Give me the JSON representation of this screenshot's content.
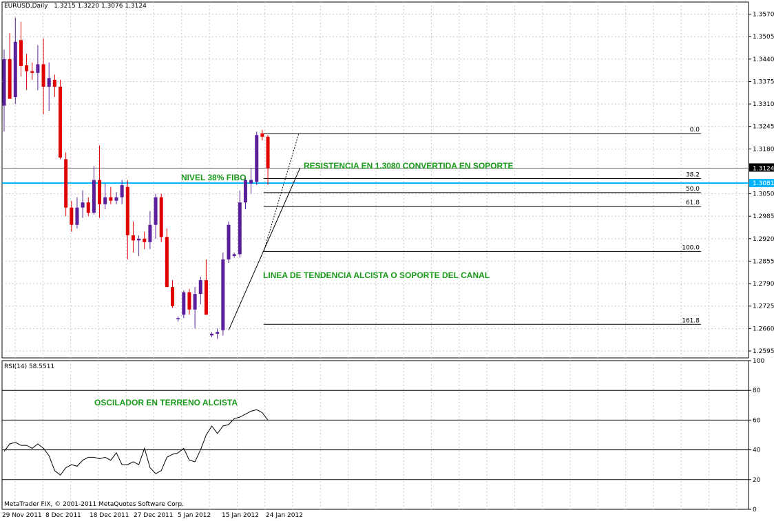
{
  "header": {
    "symbol": "EURUSD,Daily",
    "ohlc": "1.3215 1.3220 1.3076 1.3124"
  },
  "rsi_header": "RSI(14) 58.5511",
  "copyright": "MetaTrader FIX, © 2001-2011 MetaQuotes Software Corp.",
  "colors": {
    "bull": "#5b1f9c",
    "bear": "#e00000",
    "annotation": "#1a9a1a",
    "support_line": "#00b4ff",
    "grid": "#c8c8c8"
  },
  "chart_data": [
    {
      "type": "candlestick",
      "price_axis": {
        "ylim": [
          1.2575,
          1.3605
        ],
        "ticks": [
          "1.3570",
          "1.3505",
          "1.3440",
          "1.3375",
          "1.3310",
          "1.3245",
          "1.3180",
          "1.3050",
          "1.2985",
          "1.2920",
          "1.2855",
          "1.2790",
          "1.2725",
          "1.2660",
          "1.2595"
        ],
        "current_price_label": "1.3124",
        "support_label": "1.3081"
      },
      "time_axis": [
        "29 Nov 2011",
        "8 Dec 2011",
        "18 Dec 2011",
        "27 Dec 2011",
        "5 Jan 2012",
        "15 Jan 2012",
        "24 Jan 2012"
      ],
      "candles": [
        [
          1.3305,
          1.3468,
          1.323,
          1.344
        ],
        [
          1.344,
          1.3515,
          1.339,
          1.3325
        ],
        [
          1.333,
          1.356,
          1.331,
          1.349
        ],
        [
          1.3495,
          1.3548,
          1.339,
          1.342
        ],
        [
          1.3422,
          1.3455,
          1.335,
          1.3405
        ],
        [
          1.3405,
          1.343,
          1.338,
          1.34
        ],
        [
          1.34,
          1.348,
          1.335,
          1.3425
        ],
        [
          1.3425,
          1.35,
          1.328,
          1.336
        ],
        [
          1.336,
          1.343,
          1.329,
          1.3385
        ],
        [
          1.338,
          1.3395,
          1.333,
          1.336
        ],
        [
          1.336,
          1.338,
          1.315,
          1.3155
        ],
        [
          1.315,
          1.317,
          1.2985,
          1.301
        ],
        [
          1.301,
          1.303,
          1.294,
          1.296
        ],
        [
          1.296,
          1.304,
          1.295,
          1.301
        ],
        [
          1.301,
          1.306,
          1.298,
          1.3025
        ],
        [
          1.3025,
          1.304,
          1.2985,
          1.2995
        ],
        [
          1.2995,
          1.313,
          1.299,
          1.309
        ],
        [
          1.309,
          1.319,
          1.298,
          1.302
        ],
        [
          1.302,
          1.308,
          1.3005,
          1.304
        ],
        [
          1.304,
          1.307,
          1.302,
          1.303
        ],
        [
          1.303,
          1.3055,
          1.302,
          1.304
        ],
        [
          1.304,
          1.309,
          1.302,
          1.3075
        ],
        [
          1.307,
          1.309,
          1.286,
          1.293
        ],
        [
          1.293,
          1.297,
          1.288,
          1.2915
        ],
        [
          1.2915,
          1.293,
          1.287,
          1.292
        ],
        [
          1.292,
          1.294,
          1.289,
          1.291
        ],
        [
          1.291,
          1.3,
          1.289,
          1.296
        ],
        [
          1.296,
          1.305,
          1.292,
          1.304
        ],
        [
          1.304,
          1.305,
          1.291,
          1.2925
        ],
        [
          1.2925,
          1.295,
          1.278,
          1.278
        ],
        [
          1.278,
          1.28,
          1.272,
          1.2725
        ],
        [
          1.269,
          1.2695,
          1.268,
          1.269
        ],
        [
          1.27,
          1.277,
          1.269,
          1.2765
        ],
        [
          1.2765,
          1.2775,
          1.27,
          1.2715
        ],
        [
          1.2715,
          1.278,
          1.266,
          1.276
        ],
        [
          1.276,
          1.281,
          1.273,
          1.28
        ],
        [
          1.28,
          1.286,
          1.27,
          1.27
        ],
        [
          1.264,
          1.265,
          1.2635,
          1.2645
        ],
        [
          1.2645,
          1.266,
          1.263,
          1.265
        ],
        [
          1.2655,
          1.288,
          1.264,
          1.286
        ],
        [
          1.286,
          1.297,
          1.285,
          1.296
        ],
        [
          1.287,
          1.288,
          1.2865,
          1.2875
        ],
        [
          1.2875,
          1.306,
          1.2865,
          1.3025
        ],
        [
          1.3025,
          1.31,
          1.3005,
          1.309
        ],
        [
          1.308,
          1.3125,
          1.305,
          1.309
        ],
        [
          1.3085,
          1.323,
          1.3075,
          1.322
        ],
        [
          1.3225,
          1.3235,
          1.3205,
          1.3215
        ],
        [
          1.3215,
          1.322,
          1.3076,
          1.3124
        ]
      ],
      "fibonacci": {
        "high": 1.3224,
        "low": 1.2883,
        "levels": [
          {
            "label": "0.0",
            "value": 1.3224
          },
          {
            "label": "38.2",
            "value": 1.3094
          },
          {
            "label": "50.0",
            "value": 1.30535
          },
          {
            "label": "61.8",
            "value": 1.3013
          },
          {
            "label": "100.0",
            "value": 1.2883
          },
          {
            "label": "161.8",
            "value": 1.2672
          }
        ]
      },
      "current_price": 1.3124,
      "support_level": 1.3081,
      "annotations": [
        "NIVEL 38% FIBO",
        "RESISTENCIA EN 1.3080 CONVERTIDA EN SOPORTE",
        "LINEA DE TENDENCIA ALCISTA O SOPORTE DEL CANAL"
      ]
    },
    {
      "type": "line",
      "indicator": "RSI(14)",
      "ylim": [
        0,
        100
      ],
      "levels": [
        80,
        60,
        40,
        20
      ],
      "ticks": [
        "100",
        "80",
        "60",
        "40",
        "20",
        "0"
      ],
      "values": [
        39,
        44,
        45,
        43,
        43,
        41,
        44,
        41,
        36,
        26,
        23,
        28,
        30,
        29,
        33,
        35,
        35,
        34,
        35,
        33,
        38,
        30,
        30,
        32,
        30,
        41,
        28,
        24,
        26,
        35,
        37,
        38,
        41,
        33,
        32,
        40,
        50,
        56,
        51,
        56,
        57,
        61,
        62,
        64,
        66,
        67,
        65,
        60
      ],
      "annotation": "OSCILADOR EN TERRENO ALCISTA"
    }
  ]
}
